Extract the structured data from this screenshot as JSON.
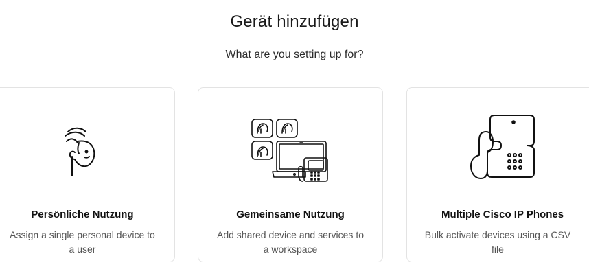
{
  "header": {
    "title": "Gerät hinzufügen",
    "subtitle": "What are you setting up for?"
  },
  "options": [
    {
      "title": "Persönliche Nutzung",
      "description": "Assign a single personal device to a user",
      "icon": "person-head-icon"
    },
    {
      "title": "Gemeinsame Nutzung",
      "description": "Add shared device and services to a workspace",
      "icon": "shared-devices-icon"
    },
    {
      "title": "Multiple Cisco IP Phones",
      "description": "Bulk activate devices using a CSV file",
      "icon": "ip-phone-icon"
    }
  ],
  "colors": {
    "card_border": "#e3e3e3",
    "text_primary": "#1a1a1a",
    "text_secondary": "#555555"
  }
}
